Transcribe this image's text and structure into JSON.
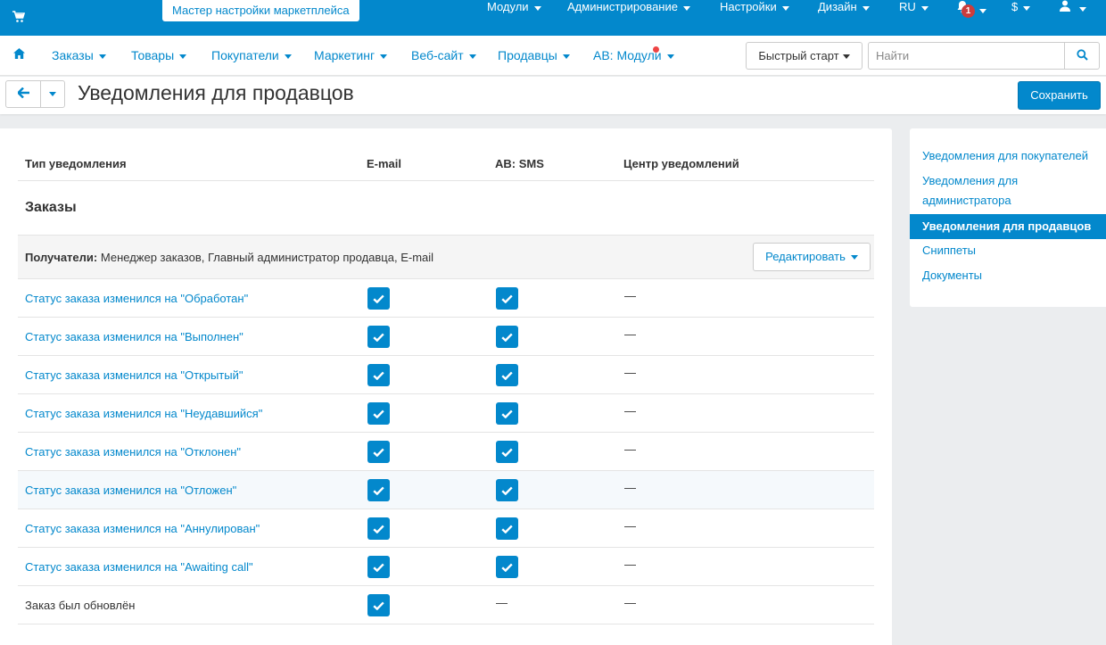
{
  "topbar": {
    "wizard_tab": "Мастер настройки маркетплейса",
    "menu": [
      {
        "label": "Модули"
      },
      {
        "label": "Администрирование"
      },
      {
        "label": "Настройки"
      },
      {
        "label": "Дизайн"
      },
      {
        "label": "RU"
      }
    ],
    "notifications_count": "1",
    "currency": "$"
  },
  "subnav": {
    "items": [
      {
        "label": "Заказы"
      },
      {
        "label": "Товары"
      },
      {
        "label": "Покупатели"
      },
      {
        "label": "Маркетинг"
      },
      {
        "label": "Веб-сайт"
      },
      {
        "label": "Продавцы"
      },
      {
        "label": "AB: Модули"
      }
    ],
    "quick_start": "Быстрый старт",
    "search_placeholder": "Найти"
  },
  "titlebar": {
    "title": "Уведомления для продавцов",
    "save_label": "Сохранить"
  },
  "table": {
    "headers": {
      "type": "Тип уведомления",
      "email": "E-mail",
      "sms": "AB: SMS",
      "center": "Центр уведомлений"
    },
    "section": "Заказы",
    "recipients_label": "Получатели:",
    "recipients_value": "Менеджер заказов, Главный администратор продавца, E-mail",
    "edit_label": "Редактировать",
    "dash": "—",
    "rows": [
      {
        "name": "Статус заказа изменился на \"Обработан\"",
        "email": true,
        "sms": true
      },
      {
        "name": "Статус заказа изменился на \"Выполнен\"",
        "email": true,
        "sms": true
      },
      {
        "name": "Статус заказа изменился на \"Открытый\"",
        "email": true,
        "sms": true
      },
      {
        "name": "Статус заказа изменился на \"Неудавшийся\"",
        "email": true,
        "sms": true
      },
      {
        "name": "Статус заказа изменился на \"Отклонен\"",
        "email": true,
        "sms": true
      },
      {
        "name": "Статус заказа изменился на \"Отложен\"",
        "email": true,
        "sms": true
      },
      {
        "name": "Статус заказа изменился на \"Аннулирован\"",
        "email": true,
        "sms": true
      },
      {
        "name": "Статус заказа изменился на \"Awaiting call\"",
        "email": true,
        "sms": true
      },
      {
        "name": "Заказ был обновлён",
        "email": true,
        "sms": false
      }
    ]
  },
  "sidebar": {
    "items": [
      {
        "label": "Уведомления для покупателей"
      },
      {
        "label": "Уведомления для администратора"
      },
      {
        "label": "Уведомления для продавцов"
      },
      {
        "label": "Сниппеты"
      },
      {
        "label": "Документы"
      }
    ]
  },
  "colors": {
    "primary": "#0388cc",
    "badge": "#cb3d3d"
  }
}
